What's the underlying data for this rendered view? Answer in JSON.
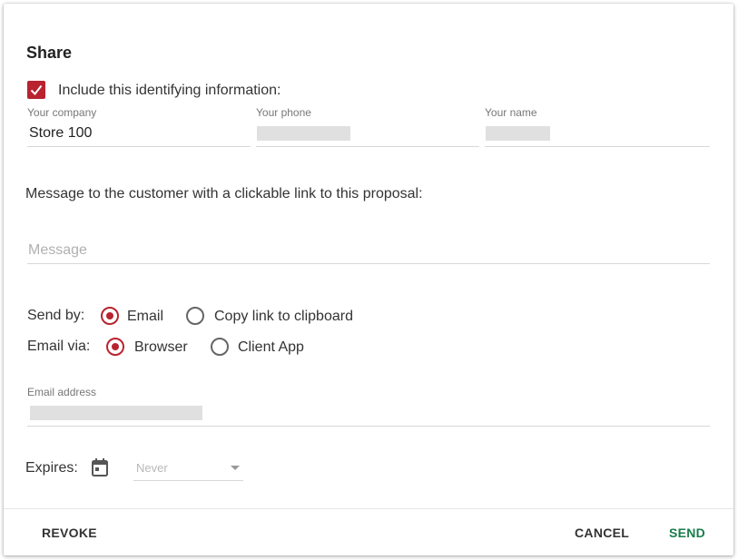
{
  "dialog": {
    "title": "Share"
  },
  "identity": {
    "include_label": "Include this identifying information:",
    "include_checked": true,
    "company_label": "Your company",
    "company_value": "Store 100",
    "phone_label": "Your phone",
    "name_label": "Your name"
  },
  "message": {
    "prompt": "Message to the customer with a clickable link to this proposal:",
    "placeholder": "Message"
  },
  "send_by": {
    "label": "Send by:",
    "options": [
      "Email",
      "Copy link to clipboard"
    ],
    "selected": "Email"
  },
  "email_via": {
    "label": "Email via:",
    "options": [
      "Browser",
      "Client App"
    ],
    "selected": "Browser"
  },
  "email_address": {
    "label": "Email address"
  },
  "expires": {
    "label": "Expires:",
    "value": "Never",
    "icon": "calendar-icon"
  },
  "footer": {
    "revoke_label": "REVOKE",
    "cancel_label": "CANCEL",
    "send_label": "SEND"
  },
  "colors": {
    "accent": "#b8232f",
    "send": "#1a7d4b"
  }
}
